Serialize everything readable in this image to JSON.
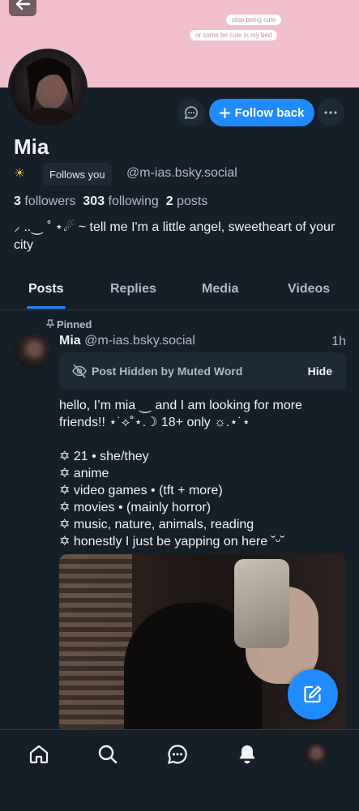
{
  "banner": {
    "pills": [
      "stop being cute",
      "or come be cute in my bed"
    ]
  },
  "profile": {
    "name": "Mia",
    "badge_emoji": "☀",
    "follows_you": "Follows you",
    "handle": "@m-ias.bsky.social",
    "followers_count": "3",
    "followers_label": "followers",
    "following_count": "303",
    "following_label": "following",
    "posts_count": "2",
    "posts_label": "posts",
    "bio": "⸝ ..⏝ ˚ ⋆☄︎ ~ tell me I'm a little angel, sweetheart of your city",
    "follow_back_label": "Follow back"
  },
  "tabs": [
    "Posts",
    "Replies",
    "Media",
    "Videos"
  ],
  "active_tab": "Posts",
  "post": {
    "pinned_label": "Pinned",
    "author_name": "Mia",
    "author_handle": "@m-ias.bsky.social",
    "time": "1h",
    "hidden_text": "Post Hidden by Muted Word",
    "hide_label": "Hide",
    "lines": [
      "hello, I’m mia ⏝ and I am looking for more",
      "friends!! ⋆˙⟡˚⋆.☽ 18+ only ☼.⋆˙⋆",
      "",
      "✡ 21 • she/they",
      "✡ anime",
      "✡ video games • (tft + more)",
      "✡ movies • (mainly horror)",
      "✡ music, nature, animals, reading",
      "✡ honestly I just be yapping on here   ˘ᵕ˘"
    ]
  },
  "nav": [
    "home-icon",
    "search-icon",
    "chat-icon",
    "bell-icon",
    "profile-avatar"
  ],
  "colors": {
    "background": "#161e27",
    "banner": "#f1bfcc",
    "accent": "#208bfe",
    "muted_text": "#aebbc9",
    "surface": "#1e2936"
  }
}
